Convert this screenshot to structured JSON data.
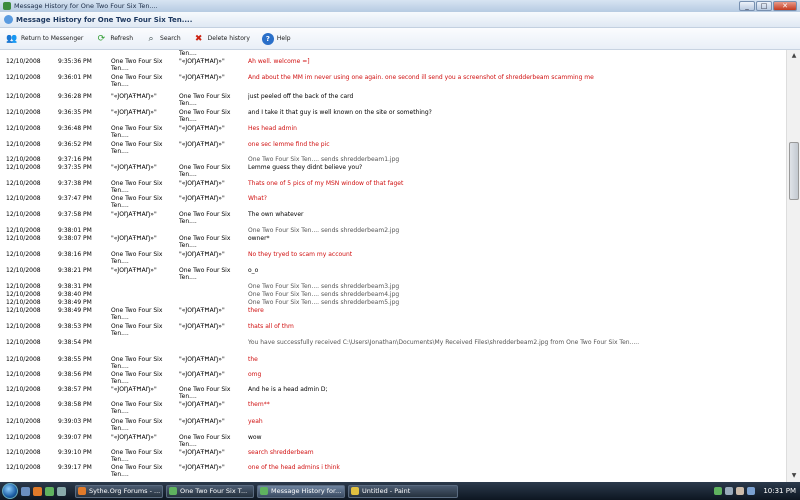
{
  "window": {
    "title": "Message History for One Two Four Six Ten...."
  },
  "header": {
    "title": "Message History for One Two Four Six Ten...."
  },
  "toolbar": {
    "return_label": "Return to Messenger",
    "refresh_label": "Refresh",
    "search_label": "Search",
    "delete_label": "Delete history",
    "help_label": "Help"
  },
  "messages": [
    {
      "date": "",
      "time": "",
      "from": "",
      "to": "Ten....",
      "text": "",
      "style": "black"
    },
    {
      "date": "12/10/2008",
      "time": "9:35:36 PM",
      "from": "One Two Four Six Ten....",
      "to": "\"«ĴÖŊÂŦĦÂŊ»\"",
      "text": "Ah well. welcome =]",
      "style": "red"
    },
    {
      "date": "12/10/2008",
      "time": "9:36:01 PM",
      "from": "One Two Four Six Ten....",
      "to": "\"«ĴÖŊÂŦĦÂŊ»\"",
      "text": "And about the MM im never using one again. one second ill send you a screenshot of shredderbeam scamming me",
      "style": "red"
    },
    {
      "date": "12/10/2008",
      "time": "9:36:28 PM",
      "from": "\"«ĴÖŊÂŦĦÂŊ»\"",
      "to": "One Two Four Six Ten....",
      "text": "just peeled off the back of the card",
      "style": "black"
    },
    {
      "date": "12/10/2008",
      "time": "9:36:35 PM",
      "from": "\"«ĴÖŊÂŦĦÂŊ»\"",
      "to": "One Two Four Six Ten....",
      "text": "and I take it that guy is well known on the site or something?",
      "style": "black"
    },
    {
      "date": "12/10/2008",
      "time": "9:36:48 PM",
      "from": "One Two Four Six Ten....",
      "to": "\"«ĴÖŊÂŦĦÂŊ»\"",
      "text": "Hes head admin",
      "style": "red"
    },
    {
      "date": "12/10/2008",
      "time": "9:36:52 PM",
      "from": "One Two Four Six Ten....",
      "to": "\"«ĴÖŊÂŦĦÂŊ»\"",
      "text": "one sec lemme find the pic",
      "style": "red"
    },
    {
      "date": "12/10/2008",
      "time": "9:37:16 PM",
      "from": "",
      "to": "",
      "text": "One Two Four Six Ten.... sends shredderbeam1.jpg",
      "style": "grey"
    },
    {
      "date": "12/10/2008",
      "time": "9:37:35 PM",
      "from": "\"«ĴÖŊÂŦĦÂŊ»\"",
      "to": "One Two Four Six Ten....",
      "text": "Lemme guess they didnt believe you?",
      "style": "black"
    },
    {
      "date": "12/10/2008",
      "time": "9:37:38 PM",
      "from": "One Two Four Six Ten....",
      "to": "\"«ĴÖŊÂŦĦÂŊ»\"",
      "text": "Thats one of 5 pics of my MSN window of that faget",
      "style": "red"
    },
    {
      "date": "12/10/2008",
      "time": "9:37:47 PM",
      "from": "One Two Four Six Ten....",
      "to": "\"«ĴÖŊÂŦĦÂŊ»\"",
      "text": "What?",
      "style": "red"
    },
    {
      "date": "12/10/2008",
      "time": "9:37:58 PM",
      "from": "\"«ĴÖŊÂŦĦÂŊ»\"",
      "to": "One Two Four Six Ten....",
      "text": "The own whatever",
      "style": "black"
    },
    {
      "date": "12/10/2008",
      "time": "9:38:01 PM",
      "from": "",
      "to": "",
      "text": "One Two Four Six Ten.... sends shredderbeam2.jpg",
      "style": "grey"
    },
    {
      "date": "12/10/2008",
      "time": "9:38:07 PM",
      "from": "\"«ĴÖŊÂŦĦÂŊ»\"",
      "to": "One Two Four Six Ten....",
      "text": "owner*",
      "style": "black"
    },
    {
      "date": "12/10/2008",
      "time": "9:38:16 PM",
      "from": "One Two Four Six Ten....",
      "to": "\"«ĴÖŊÂŦĦÂŊ»\"",
      "text": "No they tryed to scam my account",
      "style": "red"
    },
    {
      "date": "12/10/2008",
      "time": "9:38:21 PM",
      "from": "\"«ĴÖŊÂŦĦÂŊ»\"",
      "to": "One Two Four Six Ten....",
      "text": "o_o",
      "style": "black"
    },
    {
      "date": "12/10/2008",
      "time": "9:38:31 PM",
      "from": "",
      "to": "",
      "text": "One Two Four Six Ten.... sends shredderbeam3.jpg",
      "style": "grey"
    },
    {
      "date": "12/10/2008",
      "time": "9:38:40 PM",
      "from": "",
      "to": "",
      "text": "One Two Four Six Ten.... sends shredderbeam4.jpg",
      "style": "grey"
    },
    {
      "date": "12/10/2008",
      "time": "9:38:49 PM",
      "from": "",
      "to": "",
      "text": "One Two Four Six Ten.... sends shredderbeam5.jpg",
      "style": "grey"
    },
    {
      "date": "12/10/2008",
      "time": "9:38:49 PM",
      "from": "One Two Four Six Ten....",
      "to": "\"«ĴÖŊÂŦĦÂŊ»\"",
      "text": "there",
      "style": "red"
    },
    {
      "date": "12/10/2008",
      "time": "9:38:53 PM",
      "from": "One Two Four Six Ten....",
      "to": "\"«ĴÖŊÂŦĦÂŊ»\"",
      "text": "thats all of thm",
      "style": "red"
    },
    {
      "date": "12/10/2008",
      "time": "9:38:54 PM",
      "from": "",
      "to": "",
      "text": "You have successfully received C:\\Users\\Jonathan\\Documents\\My Received Files\\shredderbeam2.jpg from One Two Four Six Ten.....",
      "style": "grey"
    },
    {
      "date": "12/10/2008",
      "time": "9:38:55 PM",
      "from": "One Two Four Six Ten....",
      "to": "\"«ĴÖŊÂŦĦÂŊ»\"",
      "text": "the",
      "style": "red"
    },
    {
      "date": "12/10/2008",
      "time": "9:38:56 PM",
      "from": "One Two Four Six Ten....",
      "to": "\"«ĴÖŊÂŦĦÂŊ»\"",
      "text": "omg",
      "style": "red"
    },
    {
      "date": "12/10/2008",
      "time": "9:38:57 PM",
      "from": "\"«ĴÖŊÂŦĦÂŊ»\"",
      "to": "One Two Four Six Ten....",
      "text": "And he is a head admin D;",
      "style": "black"
    },
    {
      "date": "12/10/2008",
      "time": "9:38:58 PM",
      "from": "One Two Four Six Ten....",
      "to": "\"«ĴÖŊÂŦĦÂŊ»\"",
      "text": "them**",
      "style": "red"
    },
    {
      "date": "12/10/2008",
      "time": "9:39:03 PM",
      "from": "One Two Four Six Ten....",
      "to": "\"«ĴÖŊÂŦĦÂŊ»\"",
      "text": "yeah",
      "style": "red"
    },
    {
      "date": "12/10/2008",
      "time": "9:39:07 PM",
      "from": "\"«ĴÖŊÂŦĦÂŊ»\"",
      "to": "One Two Four Six Ten....",
      "text": "wow",
      "style": "black"
    },
    {
      "date": "12/10/2008",
      "time": "9:39:10 PM",
      "from": "One Two Four Six Ten....",
      "to": "\"«ĴÖŊÂŦĦÂŊ»\"",
      "text": "search shredderbeam",
      "style": "red"
    },
    {
      "date": "12/10/2008",
      "time": "9:39:17 PM",
      "from": "One Two Four Six Ten....",
      "to": "\"«ĴÖŊÂŦĦÂŊ»\"",
      "text": "one of the head admins i think",
      "style": "red"
    }
  ],
  "taskbar": {
    "tasks": [
      {
        "label": "Sythe.Org Forums - ...",
        "icon": "firefox-icon"
      },
      {
        "label": "One Two Four Six T...",
        "icon": "msn-icon"
      },
      {
        "label": "Message History for...",
        "icon": "msn-icon"
      },
      {
        "label": "Untitled - Paint",
        "icon": "paint-icon"
      }
    ],
    "clock": "10:31 PM"
  },
  "colors": {
    "red_message": "#d01010",
    "titlebar": "#b6cbe2",
    "taskbar": "#1a2533"
  }
}
